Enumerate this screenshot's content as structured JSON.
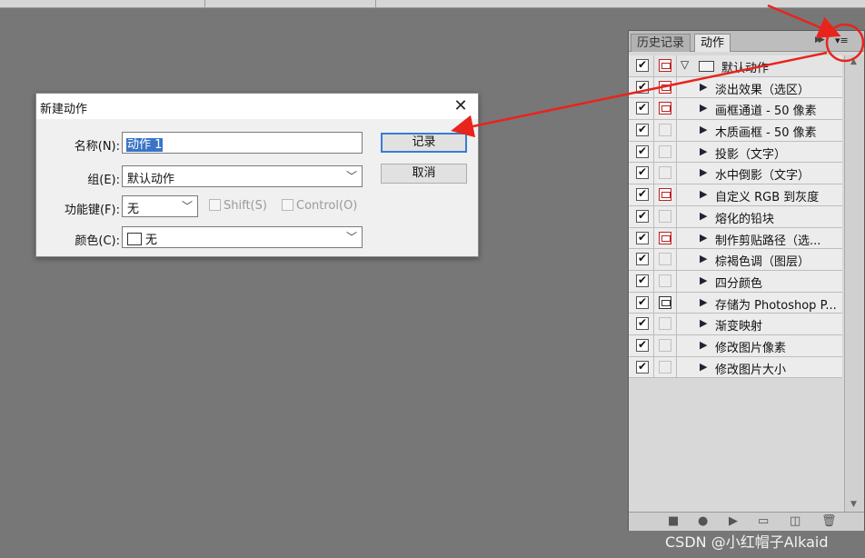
{
  "dialog": {
    "title": "新建动作",
    "name_label": "名称(N):",
    "name_value": "动作 1",
    "group_label": "组(E):",
    "group_value": "默认动作",
    "hotkey_label": "功能键(F):",
    "hotkey_value": "无",
    "shift_label": "Shift(S)",
    "control_label": "Control(O)",
    "color_label": "颜色(C):",
    "color_value": "无",
    "record_button": "记录",
    "cancel_button": "取消",
    "close_glyph": "✕"
  },
  "panel": {
    "tabs": [
      "历史记录",
      "动作"
    ],
    "active_tab": "动作",
    "menu_glyph": "▾≡",
    "set_name": "默认动作",
    "actions": [
      {
        "label": "淡出效果（选区）",
        "dialog": "red"
      },
      {
        "label": "画框通道 - 50 像素",
        "dialog": "red"
      },
      {
        "label": "木质画框 - 50 像素",
        "dialog": "none"
      },
      {
        "label": "投影（文字）",
        "dialog": "none"
      },
      {
        "label": "水中倒影（文字）",
        "dialog": "none"
      },
      {
        "label": "自定义 RGB 到灰度",
        "dialog": "red"
      },
      {
        "label": "熔化的铅块",
        "dialog": "none"
      },
      {
        "label": "制作剪贴路径（选...",
        "dialog": "red"
      },
      {
        "label": "棕褐色调（图层）",
        "dialog": "none"
      },
      {
        "label": "四分颜色",
        "dialog": "none"
      },
      {
        "label": "存储为 Photoshop P...",
        "dialog": "dark"
      },
      {
        "label": "渐变映射",
        "dialog": "none"
      },
      {
        "label": "修改图片像素",
        "dialog": "none"
      },
      {
        "label": "修改图片大小",
        "dialog": "none"
      }
    ],
    "bottom_icons": [
      "stop-icon",
      "record-icon",
      "play-icon",
      "new-set-icon",
      "new-action-icon",
      "trash-icon"
    ]
  },
  "annotation_colors": {
    "arrow": "#e8241c"
  },
  "watermark": "CSDN @小红帽子Alkaid"
}
